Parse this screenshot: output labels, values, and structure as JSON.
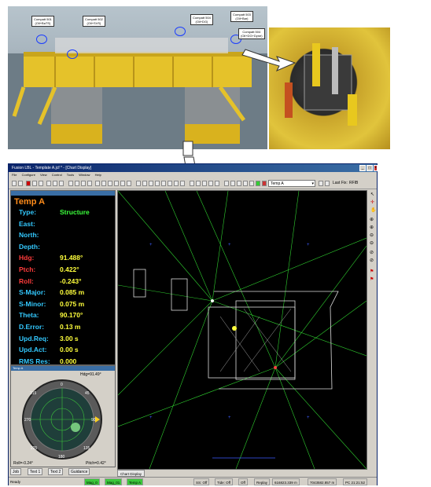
{
  "photo": {
    "callouts": [
      {
        "label": "Compatt 501",
        "sub": "(Oil+BaTS)"
      },
      {
        "label": "Compatt 502",
        "sub": "(Oil+SVS)"
      },
      {
        "label": "Compatt 504",
        "sub": "(Oil+DG)"
      },
      {
        "label": "Compatt 503",
        "sub": "(Oil+Bar)"
      },
      {
        "label": "Compatt 504",
        "sub": "(Oil+DG+Dyne)"
      }
    ]
  },
  "window": {
    "title": "Fusion LBL - Template A.jcf * - [Chart Display]",
    "menu": [
      "File",
      "Configure",
      "View",
      "Control",
      "Tools",
      "Window",
      "Help"
    ],
    "combo_value": "Temp A",
    "last_fix_label": "Last Fix:",
    "last_fix_value": "RFIB"
  },
  "panel": {
    "name": "Temp A",
    "rows": [
      {
        "label": "Type:",
        "value": "Structure",
        "label_color": "#33c9ff",
        "value_color": "#3cff3c"
      },
      {
        "label": "East:",
        "value": "",
        "label_color": "#33c9ff",
        "value_color": "#3cff3c"
      },
      {
        "label": "North:",
        "value": "",
        "label_color": "#33c9ff",
        "value_color": "#3cff3c"
      },
      {
        "label": "Depth:",
        "value": "",
        "label_color": "#33c9ff",
        "value_color": "#3cff3c"
      },
      {
        "label": "Hdg:",
        "value": "91.488°",
        "label_color": "#ff3b3b",
        "value_color": "#ffff3c"
      },
      {
        "label": "Ptch:",
        "value": "0.422°",
        "label_color": "#ff3b3b",
        "value_color": "#ffff3c"
      },
      {
        "label": "Roll:",
        "value": "-0.243°",
        "label_color": "#ff3b3b",
        "value_color": "#ffff3c"
      },
      {
        "label": "S-Major:",
        "value": "0.085 m",
        "label_color": "#33c9ff",
        "value_color": "#ffff3c"
      },
      {
        "label": "S-Minor:",
        "value": "0.075 m",
        "label_color": "#33c9ff",
        "value_color": "#ffff3c"
      },
      {
        "label": "Theta:",
        "value": "90.170°",
        "label_color": "#33c9ff",
        "value_color": "#ffff3c"
      },
      {
        "label": "D.Error:",
        "value": "0.13 m",
        "label_color": "#33c9ff",
        "value_color": "#ffff3c"
      },
      {
        "label": "Upd.Req:",
        "value": "3.00 s",
        "label_color": "#33c9ff",
        "value_color": "#ffff3c"
      },
      {
        "label": "Upd.Act:",
        "value": "0.00 s",
        "label_color": "#33c9ff",
        "value_color": "#ffff3c"
      },
      {
        "label": "RMS Res:",
        "value": "0.000",
        "label_color": "#33c9ff",
        "value_color": "#ffff3c"
      }
    ]
  },
  "compass": {
    "title": "Temp A",
    "hdg": "Hdg=91.49°",
    "roll": "Roll=-0.24°",
    "pitch": "Pitch=0.42°",
    "ticks": [
      "0",
      "45",
      "90",
      "135",
      "180",
      "225",
      "270",
      "315"
    ]
  },
  "tabs": [
    "Job",
    "Text 1",
    "Text 2",
    "Guidance"
  ],
  "chart_tab": "Chart Display",
  "status": {
    "ready": "Ready",
    "items": [
      "Mag_0",
      "Mag_01",
      "Temp A",
      "SS: Off",
      "Tide: Off",
      "Off",
      "Replay",
      "616823.339 m",
      "7043582.857 m",
      "PC 21:21:52"
    ]
  }
}
